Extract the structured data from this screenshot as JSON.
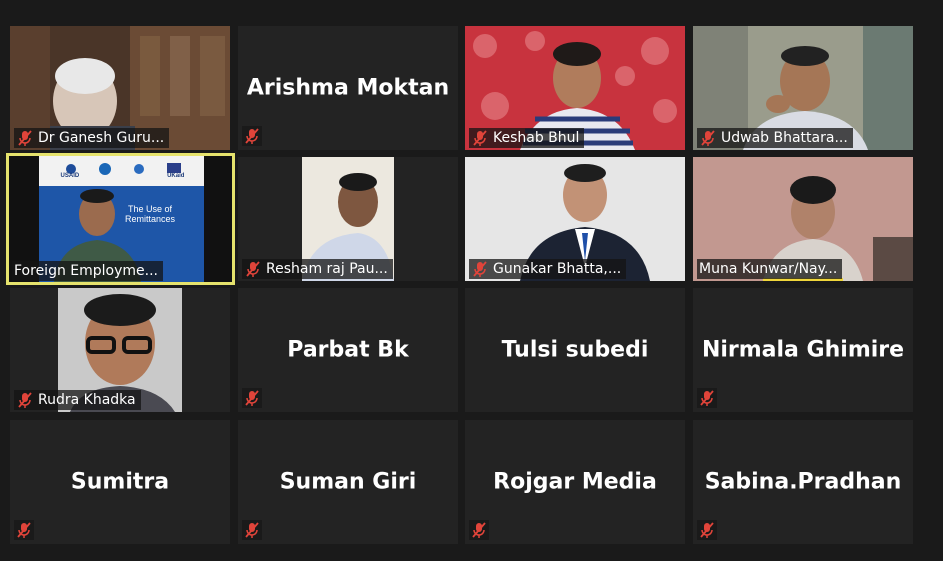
{
  "participants": [
    {
      "name": "Dr Ganesh Guru...",
      "video": true
    },
    {
      "name": "Arishma Moktan",
      "video": false
    },
    {
      "name": "Keshab Bhul",
      "video": true
    },
    {
      "name": "Udwab Bhattara...",
      "video": true
    },
    {
      "name": "Foreign Employme...",
      "video": true,
      "active_speaker": true,
      "muted": false
    },
    {
      "name": "Resham raj Pau...",
      "video": true
    },
    {
      "name": "Gunakar Bhatta,...",
      "video": true
    },
    {
      "name": "Muna Kunwar/Nay...",
      "video": true
    },
    {
      "name": "Rudra Khadka",
      "video": true
    },
    {
      "name": "Parbat Bk",
      "video": false
    },
    {
      "name": "Tulsi subedi",
      "video": false
    },
    {
      "name": "Nirmala Ghimire",
      "video": false
    },
    {
      "name": "Sumitra",
      "video": false
    },
    {
      "name": "Suman Giri",
      "video": false
    },
    {
      "name": "Rojgar Media",
      "video": false
    },
    {
      "name": "Sabina.Pradhan",
      "video": false
    }
  ],
  "slide": {
    "logos": [
      "USAID",
      "W",
      "UKaid"
    ],
    "title": "The Use of Remittances"
  },
  "colors": {
    "background": "#1a1a1a",
    "tile": "#232323",
    "active_border": "#e6e36d",
    "mute_icon": "#e0443a"
  }
}
